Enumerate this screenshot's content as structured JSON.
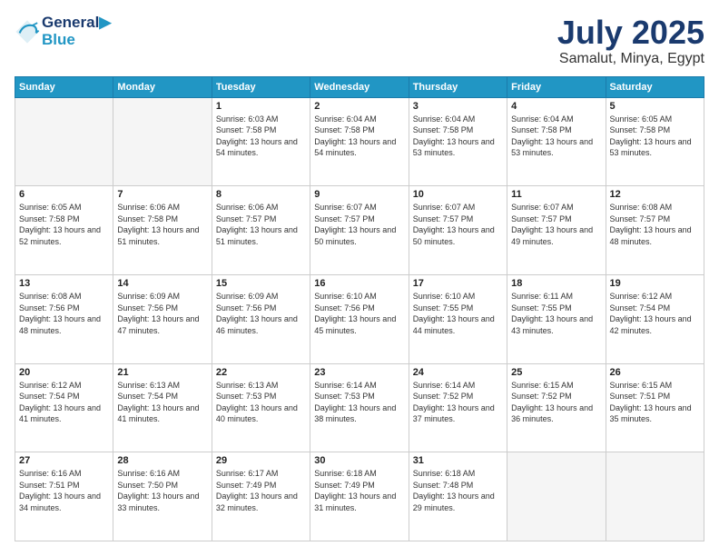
{
  "logo": {
    "line1": "General",
    "line2": "Blue"
  },
  "header": {
    "month": "July 2025",
    "location": "Samalut, Minya, Egypt"
  },
  "weekdays": [
    "Sunday",
    "Monday",
    "Tuesday",
    "Wednesday",
    "Thursday",
    "Friday",
    "Saturday"
  ],
  "weeks": [
    [
      {
        "day": "",
        "empty": true
      },
      {
        "day": "",
        "empty": true
      },
      {
        "day": "1",
        "sunrise": "6:03 AM",
        "sunset": "7:58 PM",
        "daylight": "13 hours and 54 minutes."
      },
      {
        "day": "2",
        "sunrise": "6:04 AM",
        "sunset": "7:58 PM",
        "daylight": "13 hours and 54 minutes."
      },
      {
        "day": "3",
        "sunrise": "6:04 AM",
        "sunset": "7:58 PM",
        "daylight": "13 hours and 53 minutes."
      },
      {
        "day": "4",
        "sunrise": "6:04 AM",
        "sunset": "7:58 PM",
        "daylight": "13 hours and 53 minutes."
      },
      {
        "day": "5",
        "sunrise": "6:05 AM",
        "sunset": "7:58 PM",
        "daylight": "13 hours and 53 minutes."
      }
    ],
    [
      {
        "day": "6",
        "sunrise": "6:05 AM",
        "sunset": "7:58 PM",
        "daylight": "13 hours and 52 minutes."
      },
      {
        "day": "7",
        "sunrise": "6:06 AM",
        "sunset": "7:58 PM",
        "daylight": "13 hours and 51 minutes."
      },
      {
        "day": "8",
        "sunrise": "6:06 AM",
        "sunset": "7:57 PM",
        "daylight": "13 hours and 51 minutes."
      },
      {
        "day": "9",
        "sunrise": "6:07 AM",
        "sunset": "7:57 PM",
        "daylight": "13 hours and 50 minutes."
      },
      {
        "day": "10",
        "sunrise": "6:07 AM",
        "sunset": "7:57 PM",
        "daylight": "13 hours and 50 minutes."
      },
      {
        "day": "11",
        "sunrise": "6:07 AM",
        "sunset": "7:57 PM",
        "daylight": "13 hours and 49 minutes."
      },
      {
        "day": "12",
        "sunrise": "6:08 AM",
        "sunset": "7:57 PM",
        "daylight": "13 hours and 48 minutes."
      }
    ],
    [
      {
        "day": "13",
        "sunrise": "6:08 AM",
        "sunset": "7:56 PM",
        "daylight": "13 hours and 48 minutes."
      },
      {
        "day": "14",
        "sunrise": "6:09 AM",
        "sunset": "7:56 PM",
        "daylight": "13 hours and 47 minutes."
      },
      {
        "day": "15",
        "sunrise": "6:09 AM",
        "sunset": "7:56 PM",
        "daylight": "13 hours and 46 minutes."
      },
      {
        "day": "16",
        "sunrise": "6:10 AM",
        "sunset": "7:56 PM",
        "daylight": "13 hours and 45 minutes."
      },
      {
        "day": "17",
        "sunrise": "6:10 AM",
        "sunset": "7:55 PM",
        "daylight": "13 hours and 44 minutes."
      },
      {
        "day": "18",
        "sunrise": "6:11 AM",
        "sunset": "7:55 PM",
        "daylight": "13 hours and 43 minutes."
      },
      {
        "day": "19",
        "sunrise": "6:12 AM",
        "sunset": "7:54 PM",
        "daylight": "13 hours and 42 minutes."
      }
    ],
    [
      {
        "day": "20",
        "sunrise": "6:12 AM",
        "sunset": "7:54 PM",
        "daylight": "13 hours and 41 minutes."
      },
      {
        "day": "21",
        "sunrise": "6:13 AM",
        "sunset": "7:54 PM",
        "daylight": "13 hours and 41 minutes."
      },
      {
        "day": "22",
        "sunrise": "6:13 AM",
        "sunset": "7:53 PM",
        "daylight": "13 hours and 40 minutes."
      },
      {
        "day": "23",
        "sunrise": "6:14 AM",
        "sunset": "7:53 PM",
        "daylight": "13 hours and 38 minutes."
      },
      {
        "day": "24",
        "sunrise": "6:14 AM",
        "sunset": "7:52 PM",
        "daylight": "13 hours and 37 minutes."
      },
      {
        "day": "25",
        "sunrise": "6:15 AM",
        "sunset": "7:52 PM",
        "daylight": "13 hours and 36 minutes."
      },
      {
        "day": "26",
        "sunrise": "6:15 AM",
        "sunset": "7:51 PM",
        "daylight": "13 hours and 35 minutes."
      }
    ],
    [
      {
        "day": "27",
        "sunrise": "6:16 AM",
        "sunset": "7:51 PM",
        "daylight": "13 hours and 34 minutes."
      },
      {
        "day": "28",
        "sunrise": "6:16 AM",
        "sunset": "7:50 PM",
        "daylight": "13 hours and 33 minutes."
      },
      {
        "day": "29",
        "sunrise": "6:17 AM",
        "sunset": "7:49 PM",
        "daylight": "13 hours and 32 minutes."
      },
      {
        "day": "30",
        "sunrise": "6:18 AM",
        "sunset": "7:49 PM",
        "daylight": "13 hours and 31 minutes."
      },
      {
        "day": "31",
        "sunrise": "6:18 AM",
        "sunset": "7:48 PM",
        "daylight": "13 hours and 29 minutes."
      },
      {
        "day": "",
        "empty": true
      },
      {
        "day": "",
        "empty": true
      }
    ]
  ]
}
